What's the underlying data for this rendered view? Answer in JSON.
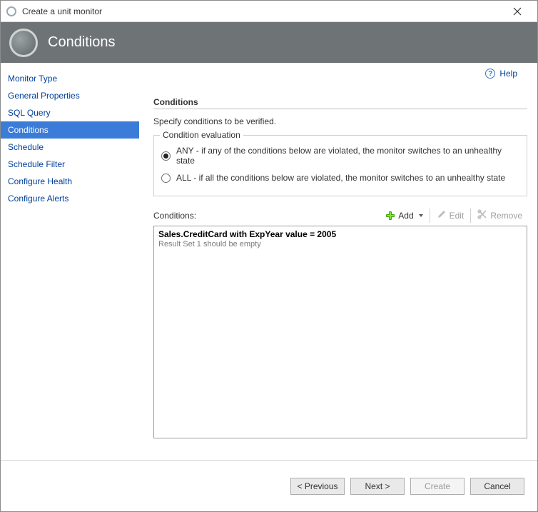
{
  "titlebar": {
    "title": "Create a unit monitor"
  },
  "header": {
    "title": "Conditions"
  },
  "sidebar": {
    "items": [
      {
        "label": "Monitor Type"
      },
      {
        "label": "General Properties"
      },
      {
        "label": "SQL Query"
      },
      {
        "label": "Conditions",
        "selected": true
      },
      {
        "label": "Schedule"
      },
      {
        "label": "Schedule Filter"
      },
      {
        "label": "Configure Health"
      },
      {
        "label": "Configure Alerts"
      }
    ]
  },
  "help": {
    "label": "Help"
  },
  "main": {
    "section_title": "Conditions",
    "subtitle": "Specify conditions to be verified.",
    "groupbox_legend": "Condition evaluation",
    "radio_any": "ANY - if any of the conditions below are violated, the monitor switches to an unhealthy state",
    "radio_all": "ALL - if all the conditions below are violated, the monitor switches to an unhealthy state",
    "radio_value": "any",
    "conditions_label": "Conditions:",
    "toolbar": {
      "add": "Add",
      "edit": "Edit",
      "remove": "Remove"
    },
    "conditions": [
      {
        "title": "Sales.CreditCard with ExpYear value = 2005",
        "sub": "Result Set 1 should be empty"
      }
    ]
  },
  "footer": {
    "previous": "< Previous",
    "next": "Next >",
    "create": "Create",
    "cancel": "Cancel"
  }
}
